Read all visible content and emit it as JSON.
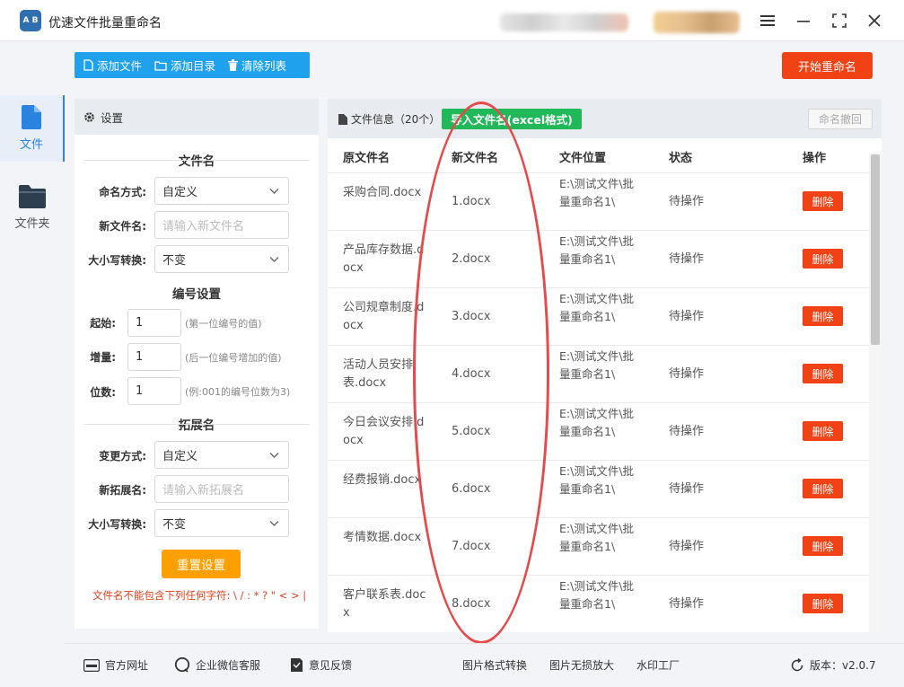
{
  "app": {
    "title": "优速文件批量重命名",
    "logo_text": "A B"
  },
  "toolbar": {
    "add_file": "添加文件",
    "add_folder": "添加目录",
    "clear_list": "清除列表",
    "start": "开始重命名"
  },
  "nav": {
    "file": "文件",
    "folder": "文件夹"
  },
  "settings": {
    "header": "设置",
    "filename_section": "文件名",
    "naming_mode_label": "命名方式:",
    "naming_mode_value": "自定义",
    "new_name_label": "新文件名:",
    "new_name_placeholder": "请输入新文件名",
    "case_label": "大小写转换:",
    "case_value": "不变",
    "numbering_section": "编号设置",
    "start_label": "起始:",
    "start_value": "1",
    "start_hint": "(第一位编号的值)",
    "step_label": "增量:",
    "step_value": "1",
    "step_hint": "(后一位编号增加的值)",
    "digits_label": "位数:",
    "digits_value": "1",
    "digits_hint": "(例:001的编号位数为3)",
    "ext_section": "拓展名",
    "change_mode_label": "变更方式:",
    "change_mode_value": "自定义",
    "new_ext_label": "新拓展名:",
    "new_ext_placeholder": "请输入新拓展名",
    "ext_case_label": "大小写转换:",
    "ext_case_value": "不变",
    "reset": "重置设置",
    "warning": "文件名不能包含下列任何字符: \\ / : * ? \" < > |"
  },
  "files": {
    "title": "文件信息（20个）",
    "import_btn": "导入文件名(excel格式)",
    "undo_btn": "命名撤回",
    "columns": [
      "原文件名",
      "新文件名",
      "文件位置",
      "状态",
      "操作"
    ],
    "rows": [
      {
        "orig": "采购合同.docx",
        "new": "1.docx",
        "loc": "E:\\测试文件\\批量重命名1\\",
        "status": "待操作",
        "action": "删除"
      },
      {
        "orig": "产品库存数据.docx",
        "new": "2.docx",
        "loc": "E:\\测试文件\\批量重命名1\\",
        "status": "待操作",
        "action": "删除"
      },
      {
        "orig": "公司规章制度.docx",
        "new": "3.docx",
        "loc": "E:\\测试文件\\批量重命名1\\",
        "status": "待操作",
        "action": "删除"
      },
      {
        "orig": "活动人员安排表.docx",
        "new": "4.docx",
        "loc": "E:\\测试文件\\批量重命名1\\",
        "status": "待操作",
        "action": "删除"
      },
      {
        "orig": "今日会议安排.docx",
        "new": "5.docx",
        "loc": "E:\\测试文件\\批量重命名1\\",
        "status": "待操作",
        "action": "删除"
      },
      {
        "orig": "经费报销.docx",
        "new": "6.docx",
        "loc": "E:\\测试文件\\批量重命名1\\",
        "status": "待操作",
        "action": "删除"
      },
      {
        "orig": "考情数据.docx",
        "new": "7.docx",
        "loc": "E:\\测试文件\\批量重命名1\\",
        "status": "待操作",
        "action": "删除"
      },
      {
        "orig": "客户联系表.docx",
        "new": "8.docx",
        "loc": "E:\\测试文件\\批量重命名1\\",
        "status": "待操作",
        "action": "删除"
      }
    ]
  },
  "footer": {
    "website": "官方网址",
    "wechat": "企业微信客服",
    "feedback": "意见反馈",
    "img_convert": "图片格式转换",
    "img_enlarge": "图片无损放大",
    "watermark": "水印工厂",
    "version": "版本：v2.0.7"
  },
  "colors": {
    "accent_blue": "#1fa1ee",
    "start_red": "#f04214",
    "import_green": "#21b85a",
    "reset_orange": "#fba000",
    "annotation_red": "#e64a4a"
  },
  "icons": [
    "app-logo-icon",
    "menu-icon",
    "minimize-icon",
    "maximize-icon",
    "close-icon",
    "file-add-icon",
    "folder-add-icon",
    "trash-icon",
    "file-nav-icon",
    "folder-nav-icon",
    "gear-icon",
    "file-info-icon",
    "chevron-down-icon",
    "website-icon",
    "wechat-icon",
    "feedback-icon",
    "refresh-icon"
  ]
}
